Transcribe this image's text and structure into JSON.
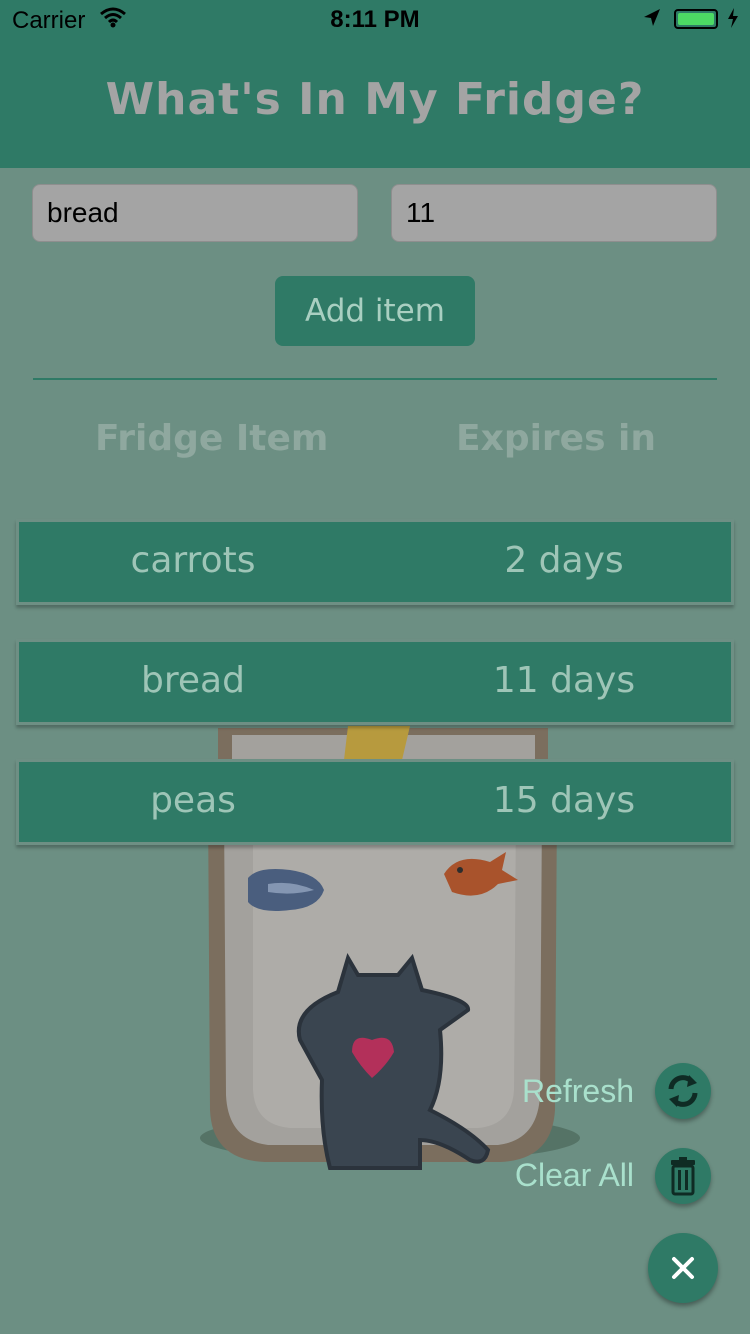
{
  "status_bar": {
    "carrier": "Carrier",
    "time": "8:11 PM"
  },
  "header": {
    "title": "What's In My Fridge?"
  },
  "form": {
    "item_value": "bread",
    "days_value": "11",
    "add_label": "Add item"
  },
  "table": {
    "headers": [
      "Fridge Item",
      "Expires in"
    ],
    "rows": [
      {
        "item": "carrots",
        "expires": "2 days"
      },
      {
        "item": "bread",
        "expires": "11 days"
      },
      {
        "item": "peas",
        "expires": "15 days"
      }
    ]
  },
  "actions": {
    "refresh_label": "Refresh",
    "clear_label": "Clear All"
  },
  "colors": {
    "primary": "#2f7a66",
    "background": "#6c8f83",
    "accent_text": "#a9e0cc"
  },
  "icons": [
    "wifi-icon",
    "location-arrow-icon",
    "battery-icon",
    "refresh-icon",
    "trash-icon",
    "close-icon"
  ]
}
